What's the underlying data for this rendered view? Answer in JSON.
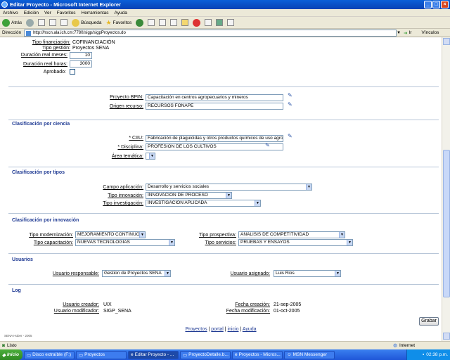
{
  "window": {
    "title": "Editar Proyecto - Microsoft Internet Explorer"
  },
  "menu": [
    "Archivo",
    "Edición",
    "Ver",
    "Favoritos",
    "Herramientas",
    "Ayuda"
  ],
  "toolbar": {
    "back": "Atrás",
    "search": "Búsqueda",
    "favorites": "Favoritos"
  },
  "address": {
    "label": "Dirección",
    "url": "http://hscn.ala.ich.cm:7780/sigp/sigpProyectos.do",
    "go": "Ir",
    "links": "Vínculos"
  },
  "top": {
    "tipo_financiacion_label": "Tipo financiación:",
    "tipo_financiacion_value": "COFINANCIACIÓN",
    "tipo_gestion_label": "Tipo gestión:",
    "tipo_gestion_value": "Proyectos SENA",
    "duracion_meses_label": "Duración real meses:",
    "duracion_meses_value": "10",
    "duracion_horas_label": "Duración real horas:",
    "duracion_horas_value": "3000",
    "aprobado_label": "Aprobado:"
  },
  "proyecto": {
    "bpin_label": "Proyecto BPIN:",
    "bpin_value": "Capacitación en centros agropecuarios y mineros",
    "origen_label": "Origen recurso:",
    "origen_value": "RECURSOS FONAPE"
  },
  "ciencia": {
    "title": "Clasificación por ciencia",
    "ciiu_label": "* CIIU:",
    "ciiu_value": "Fabricación de plaguicidas y otros productos químicos de uso agro",
    "disciplina_label": "* Disciplina:",
    "disciplina_value": "PROFESIÓN DE LOS CULTIVOS",
    "area_label": "Área temática:",
    "area_value": ""
  },
  "tipos": {
    "title": "Clasificación por tipos",
    "campo_label": "Campo aplicación:",
    "campo_value": "Desarrollo y servicios sociales",
    "innovacion_label": "Tipo innovación:",
    "innovacion_value": "INNOVACIÓN DE PROCESO",
    "investigacion_label": "Tipo investigación:",
    "investigacion_value": "INVESTIGACIÓN APLICADA"
  },
  "innovacion": {
    "title": "Clasificación por innovación",
    "modernizacion_label": "Tipo modernización:",
    "modernizacion_value": "MEJORAMIENTO CONTINUO",
    "capacitacion_label": "Tipo capacitación:",
    "capacitacion_value": "NUEVAS TECNOLOGÍAS",
    "prospectiva_label": "Tipo prospectiva:",
    "prospectiva_value": "ANÁLISIS DE COMPETITIVIDAD",
    "servicios_label": "Tipo servicios:",
    "servicios_value": "PRUEBAS Y ENSAYOS"
  },
  "usuarios": {
    "title": "Usuarios",
    "responsable_label": "Usuario responsable:",
    "responsable_value": "Gestion de Proyectos SENA",
    "asignado_label": "Usuario asignado:",
    "asignado_value": "Luis Rios"
  },
  "log": {
    "title": "Log",
    "creador_label": "Usuario creador:",
    "creador_value": "UIX",
    "modificador_label": "Usuario modificador:",
    "modificador_value": "SIGP_SENA",
    "creacion_label": "Fecha creación:",
    "creacion_value": "21-sep-2005",
    "modificacion_label": "Fecha modificación:",
    "modificacion_value": "01-oct-2005"
  },
  "footer": {
    "links": [
      "Proyectos",
      "portal",
      "inicio",
      "Ayuda"
    ],
    "copyright": "SENA Huber - 2005"
  },
  "actions": {
    "save": "Grabar"
  },
  "status": {
    "left": "Listo",
    "zone": "Internet"
  },
  "taskbar": {
    "start": "Inicio",
    "tasks": [
      "Disco extraíble (F:)",
      "Proyectos",
      "Editar Proyecto - ...",
      "ProyectoDetalle.b...",
      "Proyectos - Micros...",
      "MSN Messenger"
    ],
    "clock": "02:38 p.m."
  },
  "colors": {
    "section": "#1f3a93",
    "titlebar": "#0a5fd8",
    "taskbar": "#245edb"
  }
}
